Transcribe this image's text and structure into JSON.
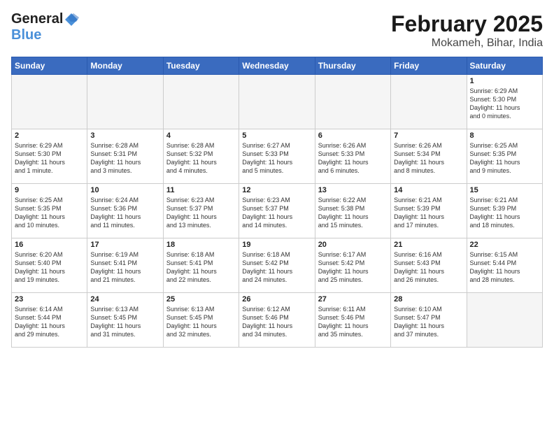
{
  "header": {
    "logo_line1": "General",
    "logo_line2": "Blue",
    "title": "February 2025",
    "subtitle": "Mokameh, Bihar, India"
  },
  "weekdays": [
    "Sunday",
    "Monday",
    "Tuesday",
    "Wednesday",
    "Thursday",
    "Friday",
    "Saturday"
  ],
  "weeks": [
    [
      {
        "day": "",
        "info": ""
      },
      {
        "day": "",
        "info": ""
      },
      {
        "day": "",
        "info": ""
      },
      {
        "day": "",
        "info": ""
      },
      {
        "day": "",
        "info": ""
      },
      {
        "day": "",
        "info": ""
      },
      {
        "day": "1",
        "info": "Sunrise: 6:29 AM\nSunset: 5:30 PM\nDaylight: 11 hours\nand 0 minutes."
      }
    ],
    [
      {
        "day": "2",
        "info": "Sunrise: 6:29 AM\nSunset: 5:30 PM\nDaylight: 11 hours\nand 1 minute."
      },
      {
        "day": "3",
        "info": "Sunrise: 6:28 AM\nSunset: 5:31 PM\nDaylight: 11 hours\nand 3 minutes."
      },
      {
        "day": "4",
        "info": "Sunrise: 6:28 AM\nSunset: 5:32 PM\nDaylight: 11 hours\nand 4 minutes."
      },
      {
        "day": "5",
        "info": "Sunrise: 6:27 AM\nSunset: 5:33 PM\nDaylight: 11 hours\nand 5 minutes."
      },
      {
        "day": "6",
        "info": "Sunrise: 6:26 AM\nSunset: 5:33 PM\nDaylight: 11 hours\nand 6 minutes."
      },
      {
        "day": "7",
        "info": "Sunrise: 6:26 AM\nSunset: 5:34 PM\nDaylight: 11 hours\nand 8 minutes."
      },
      {
        "day": "8",
        "info": "Sunrise: 6:25 AM\nSunset: 5:35 PM\nDaylight: 11 hours\nand 9 minutes."
      }
    ],
    [
      {
        "day": "9",
        "info": "Sunrise: 6:25 AM\nSunset: 5:35 PM\nDaylight: 11 hours\nand 10 minutes."
      },
      {
        "day": "10",
        "info": "Sunrise: 6:24 AM\nSunset: 5:36 PM\nDaylight: 11 hours\nand 11 minutes."
      },
      {
        "day": "11",
        "info": "Sunrise: 6:23 AM\nSunset: 5:37 PM\nDaylight: 11 hours\nand 13 minutes."
      },
      {
        "day": "12",
        "info": "Sunrise: 6:23 AM\nSunset: 5:37 PM\nDaylight: 11 hours\nand 14 minutes."
      },
      {
        "day": "13",
        "info": "Sunrise: 6:22 AM\nSunset: 5:38 PM\nDaylight: 11 hours\nand 15 minutes."
      },
      {
        "day": "14",
        "info": "Sunrise: 6:21 AM\nSunset: 5:39 PM\nDaylight: 11 hours\nand 17 minutes."
      },
      {
        "day": "15",
        "info": "Sunrise: 6:21 AM\nSunset: 5:39 PM\nDaylight: 11 hours\nand 18 minutes."
      }
    ],
    [
      {
        "day": "16",
        "info": "Sunrise: 6:20 AM\nSunset: 5:40 PM\nDaylight: 11 hours\nand 19 minutes."
      },
      {
        "day": "17",
        "info": "Sunrise: 6:19 AM\nSunset: 5:41 PM\nDaylight: 11 hours\nand 21 minutes."
      },
      {
        "day": "18",
        "info": "Sunrise: 6:18 AM\nSunset: 5:41 PM\nDaylight: 11 hours\nand 22 minutes."
      },
      {
        "day": "19",
        "info": "Sunrise: 6:18 AM\nSunset: 5:42 PM\nDaylight: 11 hours\nand 24 minutes."
      },
      {
        "day": "20",
        "info": "Sunrise: 6:17 AM\nSunset: 5:42 PM\nDaylight: 11 hours\nand 25 minutes."
      },
      {
        "day": "21",
        "info": "Sunrise: 6:16 AM\nSunset: 5:43 PM\nDaylight: 11 hours\nand 26 minutes."
      },
      {
        "day": "22",
        "info": "Sunrise: 6:15 AM\nSunset: 5:44 PM\nDaylight: 11 hours\nand 28 minutes."
      }
    ],
    [
      {
        "day": "23",
        "info": "Sunrise: 6:14 AM\nSunset: 5:44 PM\nDaylight: 11 hours\nand 29 minutes."
      },
      {
        "day": "24",
        "info": "Sunrise: 6:13 AM\nSunset: 5:45 PM\nDaylight: 11 hours\nand 31 minutes."
      },
      {
        "day": "25",
        "info": "Sunrise: 6:13 AM\nSunset: 5:45 PM\nDaylight: 11 hours\nand 32 minutes."
      },
      {
        "day": "26",
        "info": "Sunrise: 6:12 AM\nSunset: 5:46 PM\nDaylight: 11 hours\nand 34 minutes."
      },
      {
        "day": "27",
        "info": "Sunrise: 6:11 AM\nSunset: 5:46 PM\nDaylight: 11 hours\nand 35 minutes."
      },
      {
        "day": "28",
        "info": "Sunrise: 6:10 AM\nSunset: 5:47 PM\nDaylight: 11 hours\nand 37 minutes."
      },
      {
        "day": "",
        "info": ""
      }
    ]
  ]
}
